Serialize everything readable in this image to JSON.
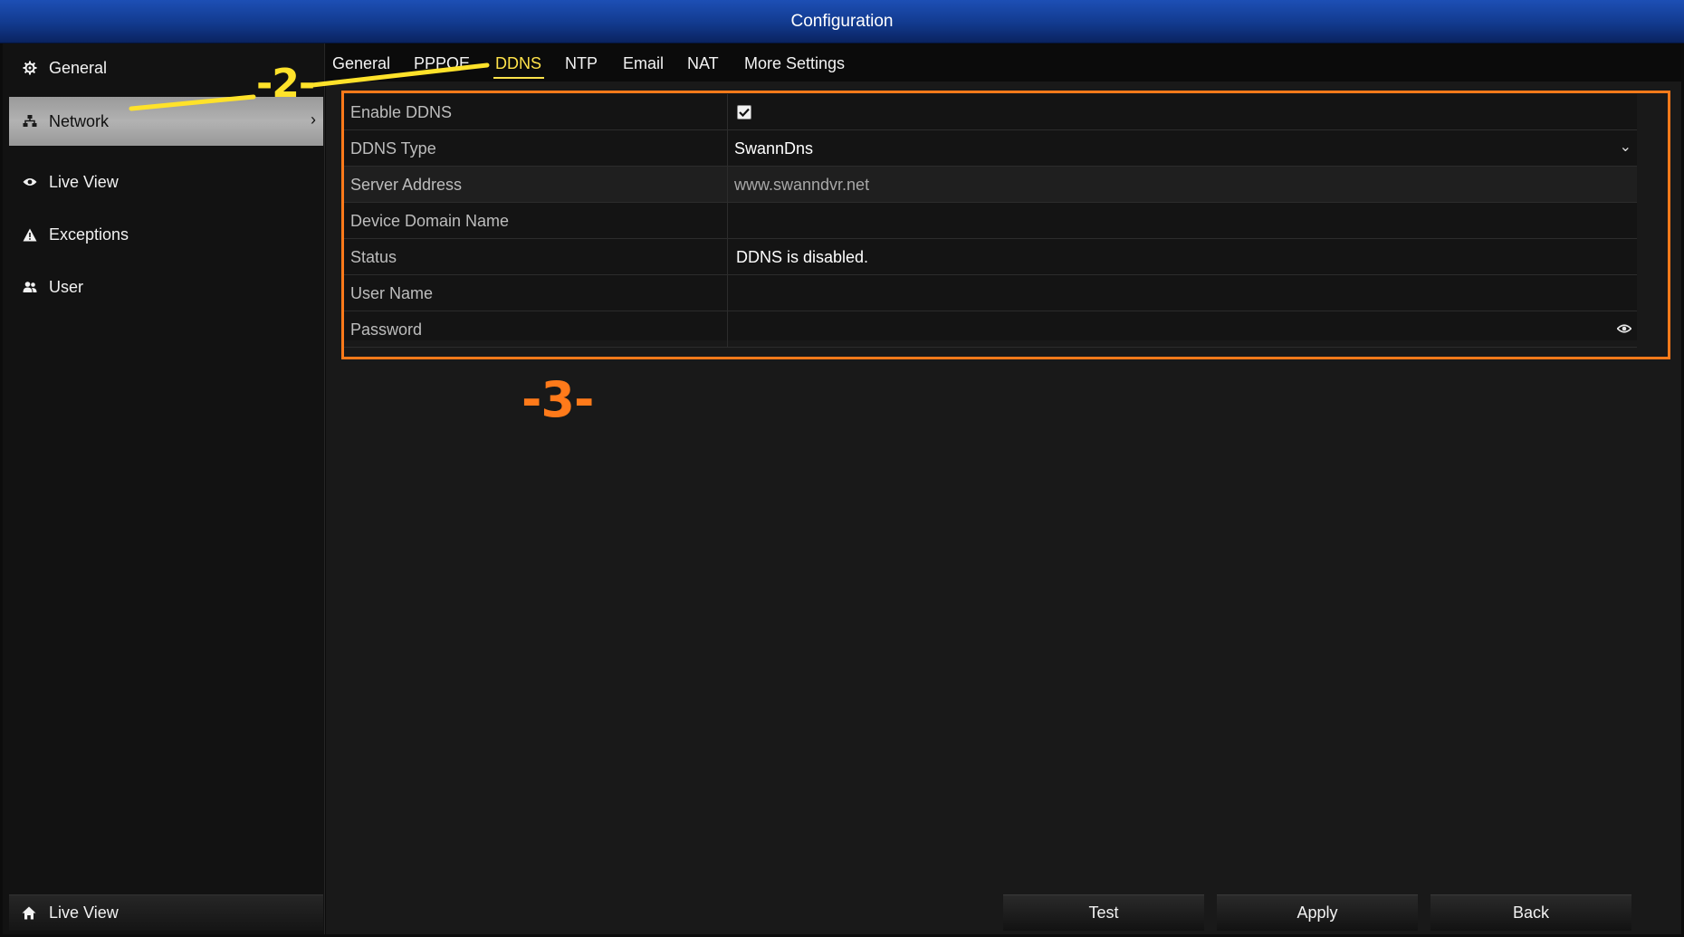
{
  "window": {
    "title": "Configuration"
  },
  "sidebar": {
    "items": [
      {
        "label": "General",
        "icon": "gear-icon"
      },
      {
        "label": "Network",
        "icon": "network-icon",
        "active": true
      },
      {
        "label": "Live View",
        "icon": "eye-icon"
      },
      {
        "label": "Exceptions",
        "icon": "warning-icon"
      },
      {
        "label": "User",
        "icon": "users-icon"
      }
    ],
    "bottom_label": "Live View",
    "bottom_icon": "home-icon"
  },
  "tabs": [
    {
      "label": "General"
    },
    {
      "label": "PPPOE"
    },
    {
      "label": "DDNS",
      "active": true
    },
    {
      "label": "NTP"
    },
    {
      "label": "Email"
    },
    {
      "label": "NAT"
    },
    {
      "label": "More Settings"
    }
  ],
  "form": {
    "enable_ddns": {
      "label": "Enable DDNS",
      "checked": true
    },
    "ddns_type": {
      "label": "DDNS Type",
      "value": "SwannDns"
    },
    "server_address": {
      "label": "Server Address",
      "value": "www.swanndvr.net"
    },
    "device_domain_name": {
      "label": "Device Domain Name",
      "value": ""
    },
    "status": {
      "label": "Status",
      "value": "DDNS is disabled."
    },
    "user_name": {
      "label": "User Name",
      "value": ""
    },
    "password": {
      "label": "Password",
      "value": ""
    }
  },
  "buttons": {
    "test": "Test",
    "apply": "Apply",
    "back": "Back"
  },
  "annotations": {
    "step2": "-2-",
    "step3": "-3-"
  },
  "colors": {
    "title_bar": "#1a4aa8",
    "active_tab": "#ffe24a",
    "annotation_yellow": "#ffe22a",
    "annotation_orange": "#ff7a1a"
  }
}
